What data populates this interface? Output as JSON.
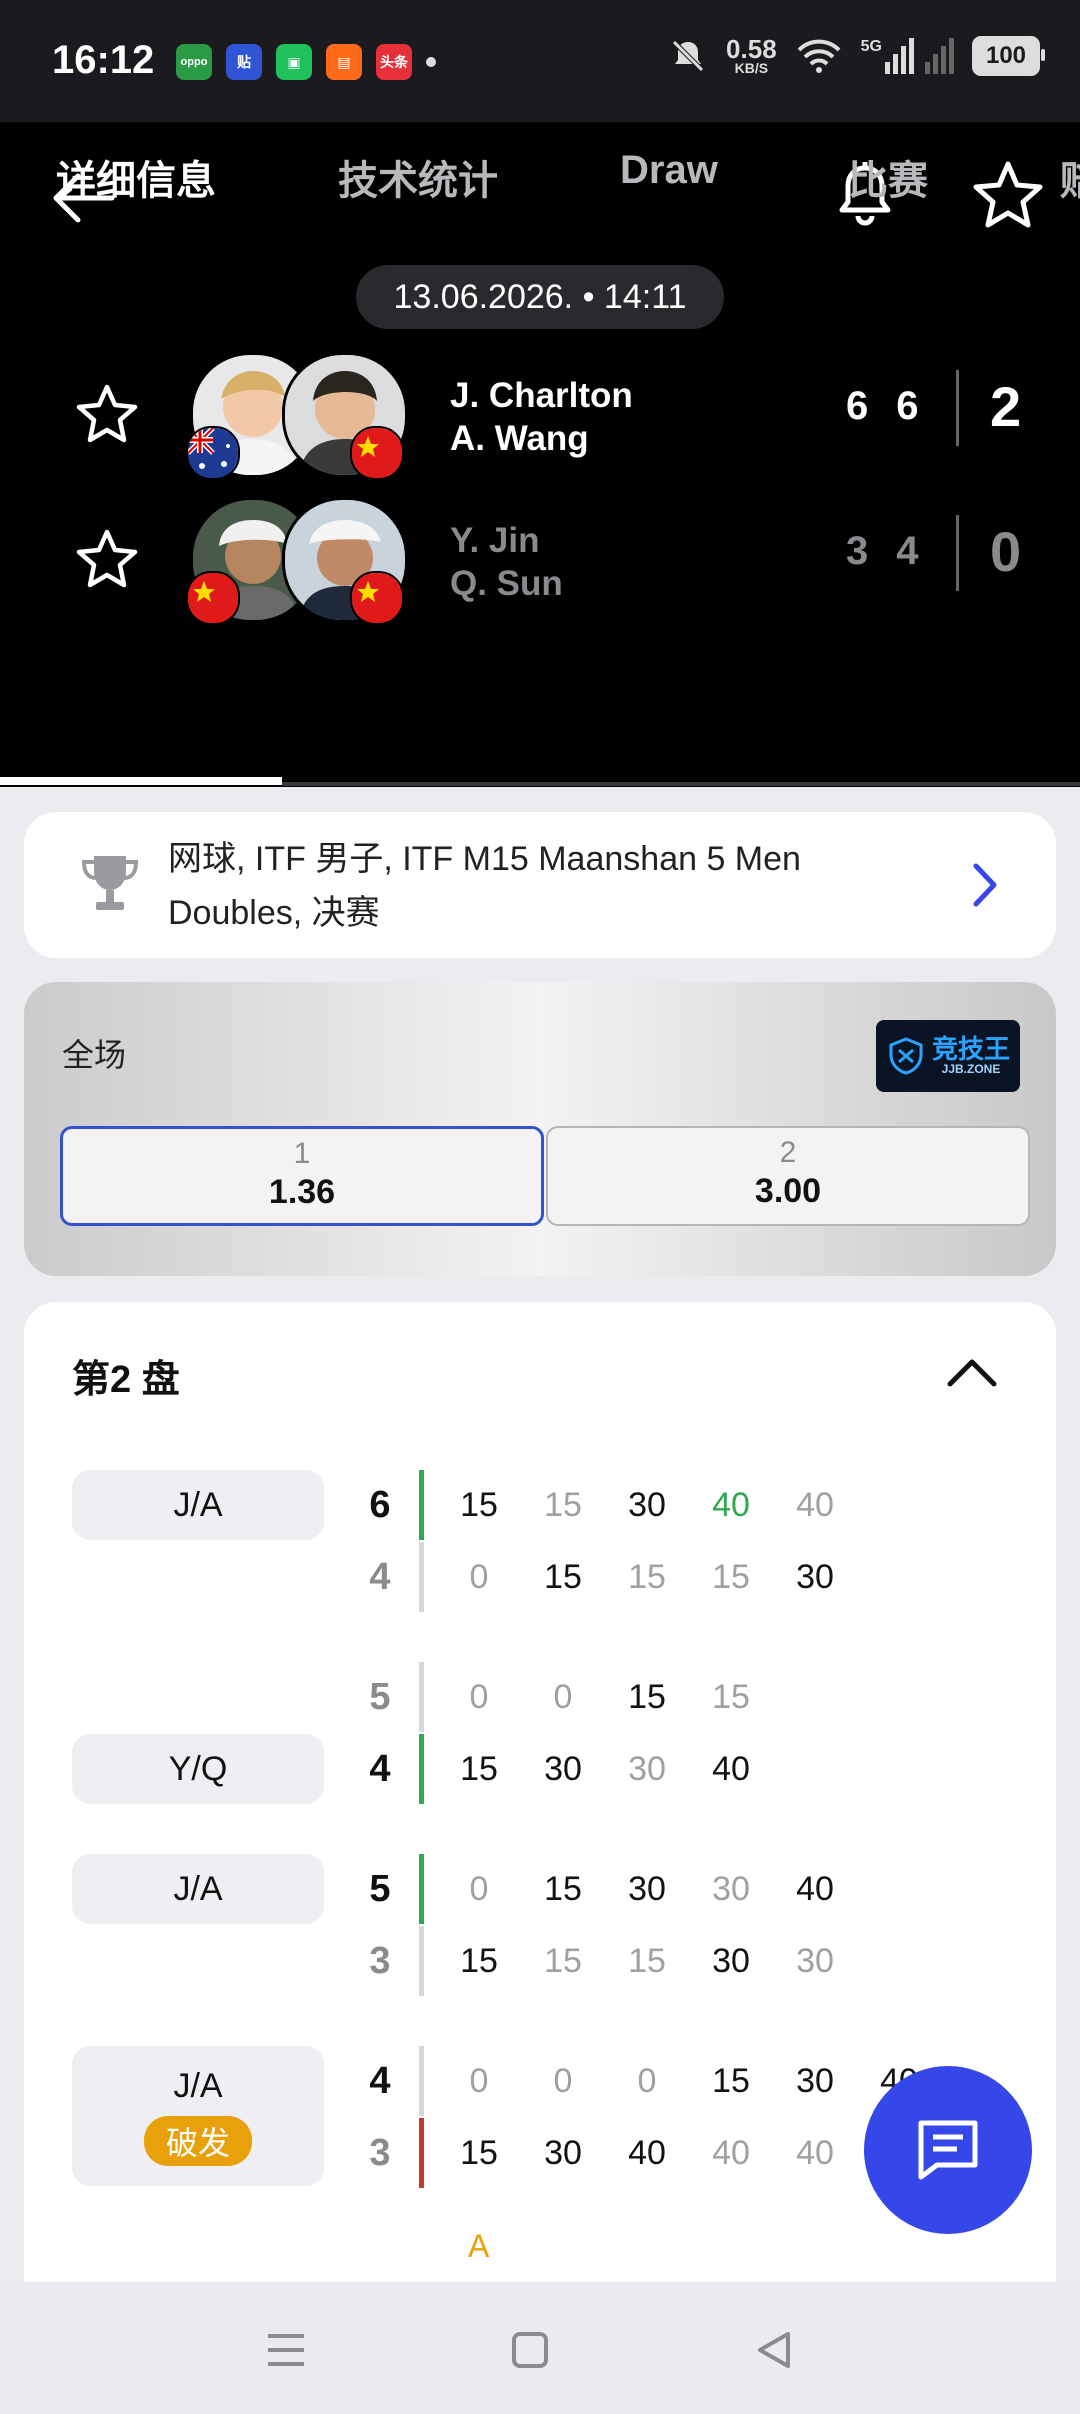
{
  "status_bar": {
    "time": "16:12",
    "net_speed": "0.58",
    "net_unit": "KB/S",
    "signal": "5G",
    "battery": "100",
    "apps": [
      {
        "name": "oppo",
        "label": "oppo",
        "color": "#2a9a45"
      },
      {
        "name": "tie",
        "label": "贴",
        "color": "#2f55d4"
      },
      {
        "name": "wechat-mini",
        "label": "▣",
        "color": "#20c05c"
      },
      {
        "name": "orange-app",
        "label": "▤",
        "color": "#ff6a1a"
      },
      {
        "name": "toutiao",
        "label": "头条",
        "color": "#e8303a"
      }
    ]
  },
  "match": {
    "datetime": "13.06.2026. • 14:11",
    "team1": {
      "player1": "J. Charlton",
      "player2": "A. Wang",
      "sets": [
        "6",
        "6"
      ],
      "total": "2"
    },
    "team2": {
      "player1": "Y. Jin",
      "player2": "Q. Sun",
      "sets": [
        "3",
        "4"
      ],
      "total": "0"
    }
  },
  "tabs": [
    {
      "label": "详细信息",
      "active": true
    },
    {
      "label": "技术统计"
    },
    {
      "label": "Draw"
    },
    {
      "label": "比赛"
    },
    {
      "label": "赔"
    }
  ],
  "tournament": {
    "text": "网球, ITF 男子, ITF M15 Maanshan 5 Men Doubles, 决赛"
  },
  "odds": {
    "label": "全场",
    "sponsor": "竞技王",
    "sponsor_sub": "JJB.ZONE",
    "options": [
      {
        "label": "1",
        "value": "1.36",
        "selected": true
      },
      {
        "label": "2",
        "value": "3.00",
        "selected": false
      }
    ]
  },
  "set_section": {
    "title": "第2 盘",
    "games": [
      {
        "server": "J/A",
        "top": {
          "score": "6",
          "pts": [
            "15",
            "15",
            "30",
            "40",
            "40"
          ]
        },
        "bottom": {
          "score": "4",
          "pts": [
            "0",
            "15",
            "15",
            "15",
            "30"
          ]
        }
      },
      {
        "server": "Y/Q",
        "top": {
          "score": "5",
          "pts": [
            "0",
            "0",
            "15",
            "15"
          ]
        },
        "bottom": {
          "score": "4",
          "pts": [
            "15",
            "30",
            "30",
            "40"
          ]
        }
      },
      {
        "server": "J/A",
        "top": {
          "score": "5",
          "pts": [
            "0",
            "15",
            "30",
            "30",
            "40"
          ]
        },
        "bottom": {
          "score": "3",
          "pts": [
            "15",
            "15",
            "15",
            "30",
            "30"
          ]
        }
      },
      {
        "server": "J/A",
        "badge": "破发",
        "top": {
          "score": "4",
          "pts": [
            "0",
            "0",
            "0",
            "15",
            "30",
            "40"
          ]
        },
        "bottom": {
          "score": "3",
          "pts": [
            "15",
            "30",
            "40",
            "40",
            "40"
          ]
        },
        "advantage": "A"
      }
    ]
  },
  "colors": {
    "accent": "#3547e8",
    "green": "#2fa84f",
    "red": "#c0392b",
    "break": "#e8a10a"
  }
}
